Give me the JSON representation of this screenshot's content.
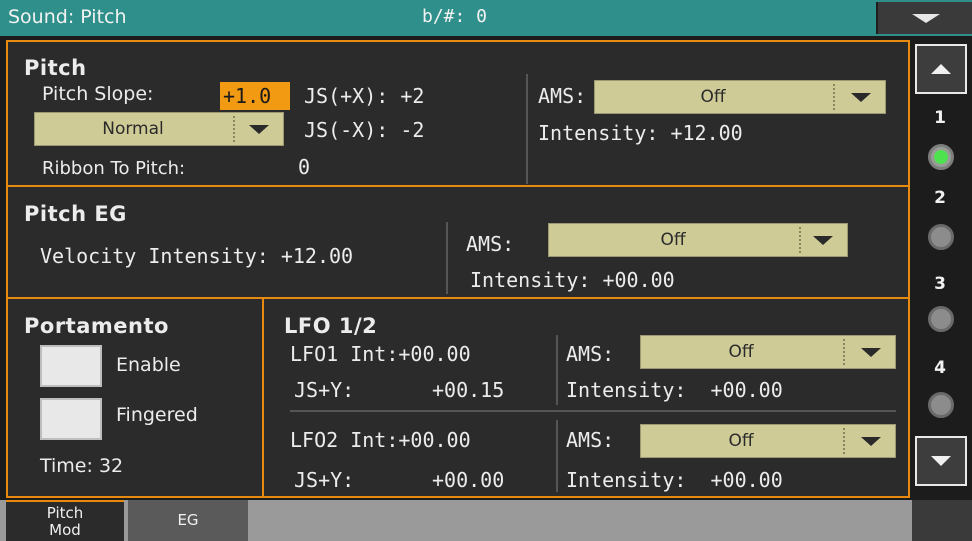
{
  "header": {
    "title": "Sound: Pitch",
    "transpose": "b/#: 0"
  },
  "pitch": {
    "title": "Pitch",
    "slope_label": "Pitch Slope:",
    "slope_value": "+1.0",
    "js_x_pos": "JS(+X): +2",
    "js_x_neg": "JS(-X): -2",
    "mode_value": "Normal",
    "ribbon_label": "Ribbon To Pitch:",
    "ribbon_value": "0",
    "ams_label": "AMS:",
    "ams_value": "Off",
    "intensity": "Intensity: +12.00"
  },
  "pitch_eg": {
    "title": "Pitch EG",
    "velocity": "Velocity Intensity: +12.00",
    "ams_label": "AMS:",
    "ams_value": "Off",
    "intensity": "Intensity: +00.00"
  },
  "portamento": {
    "title": "Portamento",
    "enable_label": "Enable",
    "fingered_label": "Fingered",
    "time": "Time: 32"
  },
  "lfo": {
    "title": "LFO 1/2",
    "lfo1_int": "LFO1 Int:+00.00",
    "lfo1_js": "JS+Y:",
    "lfo1_js_value": "+00.15",
    "lfo1_ams_label": "AMS:",
    "lfo1_ams_value": "Off",
    "lfo1_intensity": "Intensity:  +00.00",
    "lfo2_int": "LFO2 Int:+00.00",
    "lfo2_js": "JS+Y:",
    "lfo2_js_value": "+00.00",
    "lfo2_ams_label": "AMS:",
    "lfo2_ams_value": "Off",
    "lfo2_intensity": "Intensity:  +00.00"
  },
  "sidebar": {
    "layers": [
      "1",
      "2",
      "3",
      "4"
    ],
    "active_layer": "1"
  },
  "tabs": {
    "pitch_mod_line1": "Pitch",
    "pitch_mod_line2": "Mod",
    "eg": "EG"
  },
  "colors": {
    "header_bg": "#2f8f8a",
    "accent": "#e88a10",
    "highlight": "#f29a12",
    "dropdown": "#cfcb97",
    "led_on": "#4fe24f"
  }
}
